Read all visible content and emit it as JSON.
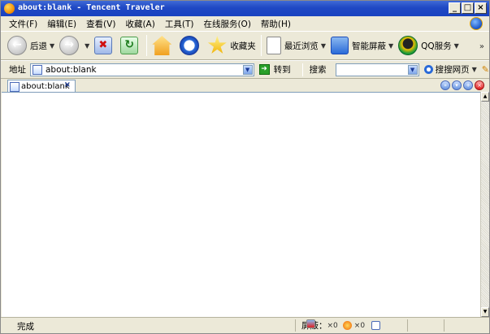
{
  "window": {
    "title": "about:blank - Tencent Traveler",
    "controls": [
      "_",
      "□",
      "×"
    ]
  },
  "menu": [
    "文件(F)",
    "编辑(E)",
    "查看(V)",
    "收藏(A)",
    "工具(T)",
    "在线服务(O)",
    "帮助(H)"
  ],
  "toolbar": {
    "back_label": "后退",
    "favorites_label": "收藏夹",
    "recent_label": "最近浏览",
    "smart_block_label": "智能屏蔽",
    "qq_label": "QQ服务",
    "more": "»"
  },
  "address": {
    "label": "地址",
    "value": "about:blank",
    "go_label": "转到",
    "search_label": "搜索",
    "search_value": "",
    "engine_label": "搜搜网页"
  },
  "tabs": [
    {
      "label": "about:blank",
      "close": "×"
    }
  ],
  "status": {
    "text": "完成",
    "block_label": "屏蔽：",
    "popup_count": "×0",
    "ad_count": "×0"
  },
  "colors": {
    "chrome": "#ece9d8",
    "titlebar": "#1f48c4",
    "content": "#ffffff"
  }
}
